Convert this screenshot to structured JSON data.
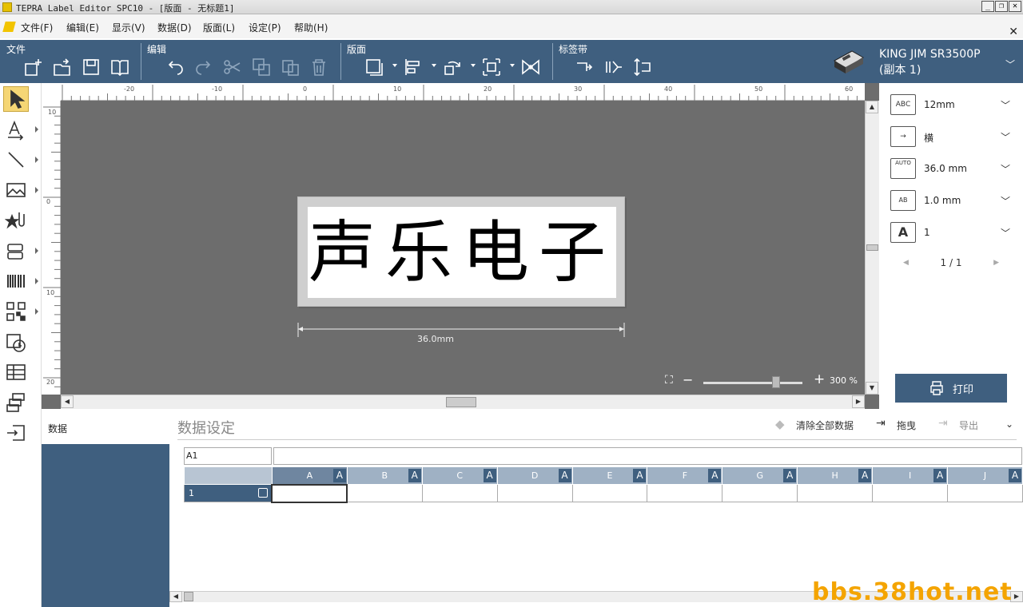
{
  "window": {
    "title": "TEPRA Label Editor SPC10 - [版面 - 无标题1]"
  },
  "menu": {
    "items": [
      "文件(F)",
      "编辑(E)",
      "显示(V)",
      "数据(D)",
      "版面(L)",
      "设定(P)",
      "帮助(H)"
    ]
  },
  "ribbon": {
    "groups": {
      "file": "文件",
      "edit": "编辑",
      "layout": "版面",
      "tape": "标签带"
    },
    "printer_name": "KING JIM SR3500P",
    "printer_copy": "(副本 1)"
  },
  "canvas": {
    "label_text": "声乐电子",
    "tape_length": "36.0mm",
    "zoom": "300 %",
    "hruler_labels": [
      "-20",
      "-10",
      "0",
      "10",
      "20",
      "30",
      "40",
      "50",
      "60"
    ],
    "vruler_labels": [
      "10",
      "0",
      "10",
      "20"
    ]
  },
  "properties": {
    "tape_width": "12mm",
    "direction": "横",
    "length": "36.0 mm",
    "margin": "1.0 mm",
    "copies": "1",
    "tape_icon_label": "ABC",
    "length_icon_label": "AUTO",
    "margin_icon_label": "AB",
    "copies_icon_label": "A"
  },
  "page_nav": {
    "text": "1 / 1"
  },
  "print_button": {
    "label": "打印"
  },
  "data_panel": {
    "side_title": "数据",
    "title": "数据设定",
    "clear_all": "清除全部数据",
    "drag": "拖曳",
    "export": "导出",
    "cell_ref": "A1",
    "columns": [
      "A",
      "B",
      "C",
      "D",
      "E",
      "F",
      "G",
      "H",
      "I",
      "J"
    ],
    "column_badge": "A",
    "rows": [
      "1"
    ]
  },
  "watermark": "bbs.38hot.net"
}
